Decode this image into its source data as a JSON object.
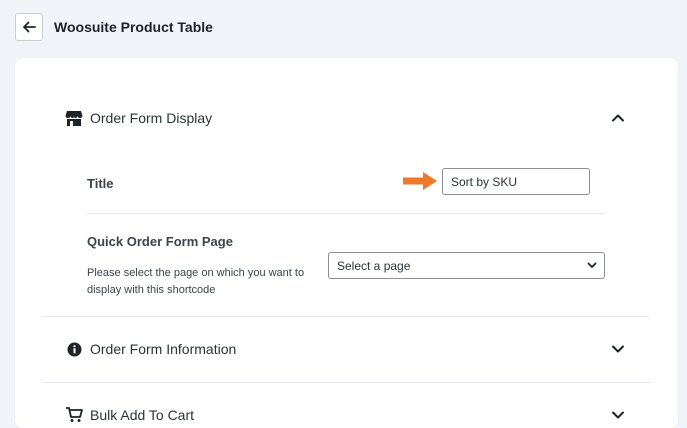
{
  "header": {
    "back_icon": "arrow-left-icon",
    "title": "Woosuite Product Table"
  },
  "sections": [
    {
      "icon": "store-icon",
      "label": "Order Form Display",
      "expanded": true,
      "fields": {
        "title_label": "Title",
        "title_value": "Sort by SKU",
        "page_label": "Quick Order Form Page",
        "page_description": "Please select the page on which you want to display with this shortcode",
        "page_select_value": "Select a page"
      }
    },
    {
      "icon": "info-circle-icon",
      "label": "Order Form Information",
      "expanded": false
    },
    {
      "icon": "cart-icon",
      "label": "Bulk Add To Cart",
      "expanded": false
    }
  ],
  "colors": {
    "accent_arrow": "#f0782a",
    "background": "#f1f4f8",
    "card": "#ffffff"
  }
}
